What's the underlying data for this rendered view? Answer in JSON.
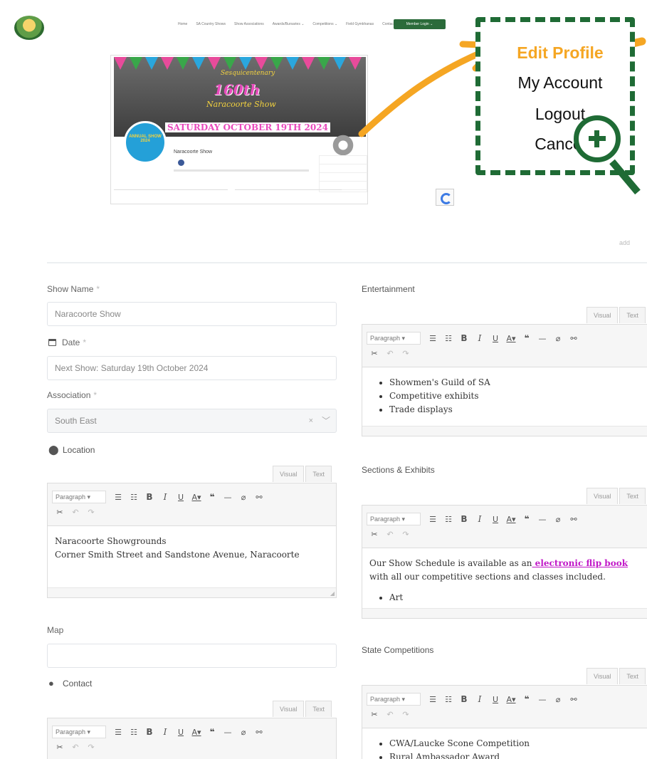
{
  "top": {
    "nav": [
      "Home",
      "SA Country Shows",
      "Show Associations",
      "Awards/Bursaries ⌄",
      "Competitions ⌄",
      "Field Gymkhanas",
      "Contact"
    ],
    "member_button": "Member Login ⌄",
    "banner": {
      "subtitle": "Sesquicentenary",
      "number": "160th",
      "town": "Naracoorte Show",
      "date": "SATURDAY OCTOBER 19TH 2024",
      "badge": "ANNUAL SHOW 2024"
    },
    "card_name": "Naracoorte Show"
  },
  "callout": {
    "items": [
      "Edit Profile",
      "My Account",
      "Logout",
      "Cancel"
    ]
  },
  "form": {
    "show_name": {
      "label": "Show Name",
      "value": "Naracoorte Show"
    },
    "date": {
      "label": "Date",
      "value": "Next Show: Saturday 19th October 2024"
    },
    "association": {
      "label": "Association",
      "value": "South East"
    },
    "location": {
      "label": "Location"
    },
    "location_content": [
      "Naracoorte Showgrounds",
      "Corner Smith Street and Sandstone Avenue, Naracoorte"
    ],
    "map": {
      "label": "Map",
      "value": ""
    },
    "contact": {
      "label": "Contact"
    },
    "entertainment": {
      "label": "Entertainment",
      "items": [
        "Showmen's Guild of SA",
        "Competitive exhibits",
        "Trade displays"
      ]
    },
    "sections": {
      "label": "Sections & Exhibits",
      "text_before": "Our Show Schedule is available as an",
      "link": " electronic flip book",
      "text_after": "with all our competitive sections and classes included.",
      "items": [
        "Art"
      ]
    },
    "state": {
      "label": "State Competitions",
      "items": [
        "CWA/Laucke Scone Competition",
        "Rural Ambassador Award"
      ]
    }
  },
  "editor": {
    "tab_visual": "Visual",
    "tab_text": "Text",
    "paragraph": "Paragraph",
    "required_mark": "*"
  }
}
